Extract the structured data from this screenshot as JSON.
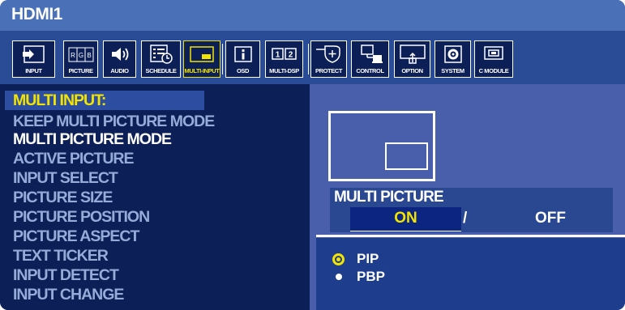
{
  "window": {
    "title": "HDMI1"
  },
  "toolbar": {
    "items": [
      {
        "label": "INPUT",
        "icon": "input-arrow-icon"
      },
      {
        "label": "PICTURE",
        "icon": "rgb-icon"
      },
      {
        "label": "AUDIO",
        "icon": "speaker-icon"
      },
      {
        "label": "SCHEDULE",
        "icon": "schedule-icon"
      },
      {
        "label": "MULTI-INPUT",
        "icon": "multi-input-icon",
        "active": true
      },
      {
        "label": "OSD",
        "icon": "info-icon"
      },
      {
        "label": "MULTI-DSP",
        "icon": "multi-display-icon"
      },
      {
        "label": "PROTECT",
        "icon": "shield-icon"
      },
      {
        "label": "CONTROL",
        "icon": "control-icon"
      },
      {
        "label": "OPTION",
        "icon": "option-icon"
      },
      {
        "label": "SYSTEM",
        "icon": "system-icon"
      },
      {
        "label": "C MODULE",
        "icon": "compute-module-icon"
      }
    ]
  },
  "menu": {
    "header": "MULTI INPUT:",
    "items": [
      "KEEP MULTI PICTURE MODE",
      "MULTI PICTURE MODE",
      "ACTIVE PICTURE",
      "INPUT SELECT",
      "PICTURE SIZE",
      "PICTURE POSITION",
      "PICTURE ASPECT",
      "TEXT TICKER",
      "INPUT DETECT",
      "INPUT CHANGE"
    ],
    "selected": "MULTI PICTURE MODE"
  },
  "multi_picture": {
    "label": "MULTI PICTURE",
    "on": "ON",
    "separator": "/",
    "off": "OFF",
    "value": "ON"
  },
  "options": [
    {
      "label": "PIP",
      "selected": true
    },
    {
      "label": "PBP",
      "selected": false
    }
  ],
  "colors": {
    "background": "#0d1f57",
    "title_bar": "#4a71b8",
    "toolbar": "#2a4b96",
    "right_panel": "#4a5fac",
    "highlight": "#f2e400",
    "menu_text_dim": "#96acd8"
  }
}
